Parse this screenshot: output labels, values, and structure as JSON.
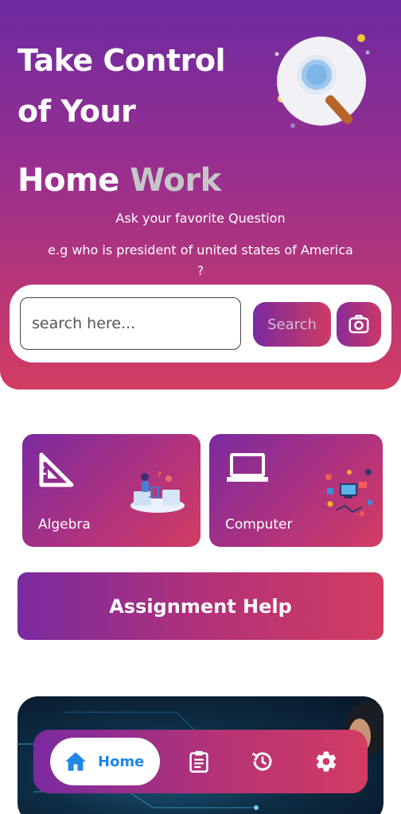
{
  "hero": {
    "title_line1": "Take Control",
    "title_line2": "of Your",
    "title_line3_a": "Home",
    "title_line3_b": "Work",
    "subtitle": "Ask your favorite Question",
    "example_line1": "e.g who is president of united states of America",
    "example_line2": "?"
  },
  "search": {
    "placeholder": "search here...",
    "value": "",
    "button_label": "Search",
    "camera_icon": "camera-icon"
  },
  "categories": [
    {
      "label": "Algebra",
      "icon": "set-square-ruler-icon"
    },
    {
      "label": "Computer",
      "icon": "laptop-icon"
    }
  ],
  "assignment": {
    "label": "Assignment Help"
  },
  "bottom_nav": {
    "items": [
      {
        "label": "Home",
        "icon": "home-icon",
        "active": true
      },
      {
        "label": "",
        "icon": "clipboard-icon",
        "active": false
      },
      {
        "label": "",
        "icon": "history-icon",
        "active": false
      },
      {
        "label": "",
        "icon": "settings-icon",
        "active": false
      }
    ]
  },
  "colors": {
    "gradient_start": "#7a2aa0",
    "gradient_end": "#d23c62",
    "home_accent": "#1e88e5"
  }
}
